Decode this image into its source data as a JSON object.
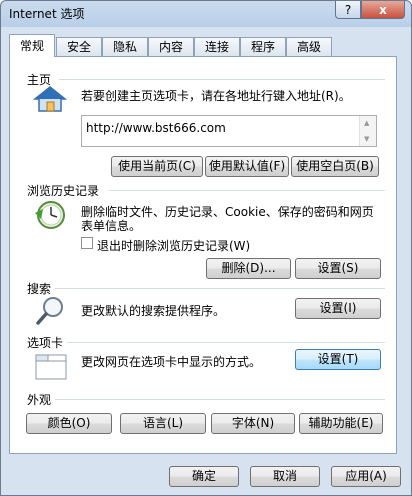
{
  "window": {
    "title": "Internet 选项",
    "help_label": "?",
    "close_label": "x"
  },
  "tabs": [
    {
      "label": "常规"
    },
    {
      "label": "安全"
    },
    {
      "label": "隐私"
    },
    {
      "label": "内容"
    },
    {
      "label": "连接"
    },
    {
      "label": "程序"
    },
    {
      "label": "高级"
    }
  ],
  "homepage": {
    "section_title": "主页",
    "description": "若要创建主页选项卡，请在各地址行键入地址(R)。",
    "url": "http://www.bst666.com",
    "use_current": "使用当前页(C)",
    "use_default": "使用默认值(F)",
    "use_blank": "使用空白页(B)"
  },
  "history": {
    "section_title": "浏览历史记录",
    "description_line1": "删除临时文件、历史记录、Cookie、保存的密码和网页",
    "description_line2": "表单信息。",
    "checkbox_label": "退出时删除浏览历史记录(W)",
    "delete_button": "删除(D)...",
    "settings_button": "设置(S)"
  },
  "search": {
    "section_title": "搜索",
    "description": "更改默认的搜索提供程序。",
    "settings_button": "设置(I)"
  },
  "tabs_section": {
    "section_title": "选项卡",
    "description": "更改网页在选项卡中显示的方式。",
    "settings_button": "设置(T)"
  },
  "appearance": {
    "section_title": "外观",
    "colors": "颜色(O)",
    "languages": "语言(L)",
    "fonts": "字体(N)",
    "accessibility": "辅助功能(E)"
  },
  "footer": {
    "ok": "确定",
    "cancel": "取消",
    "apply": "应用(A)"
  },
  "colors": {
    "tab_selected": "#ffffff",
    "focus_button": "#bee6fd",
    "close_button": "#c8513d"
  }
}
